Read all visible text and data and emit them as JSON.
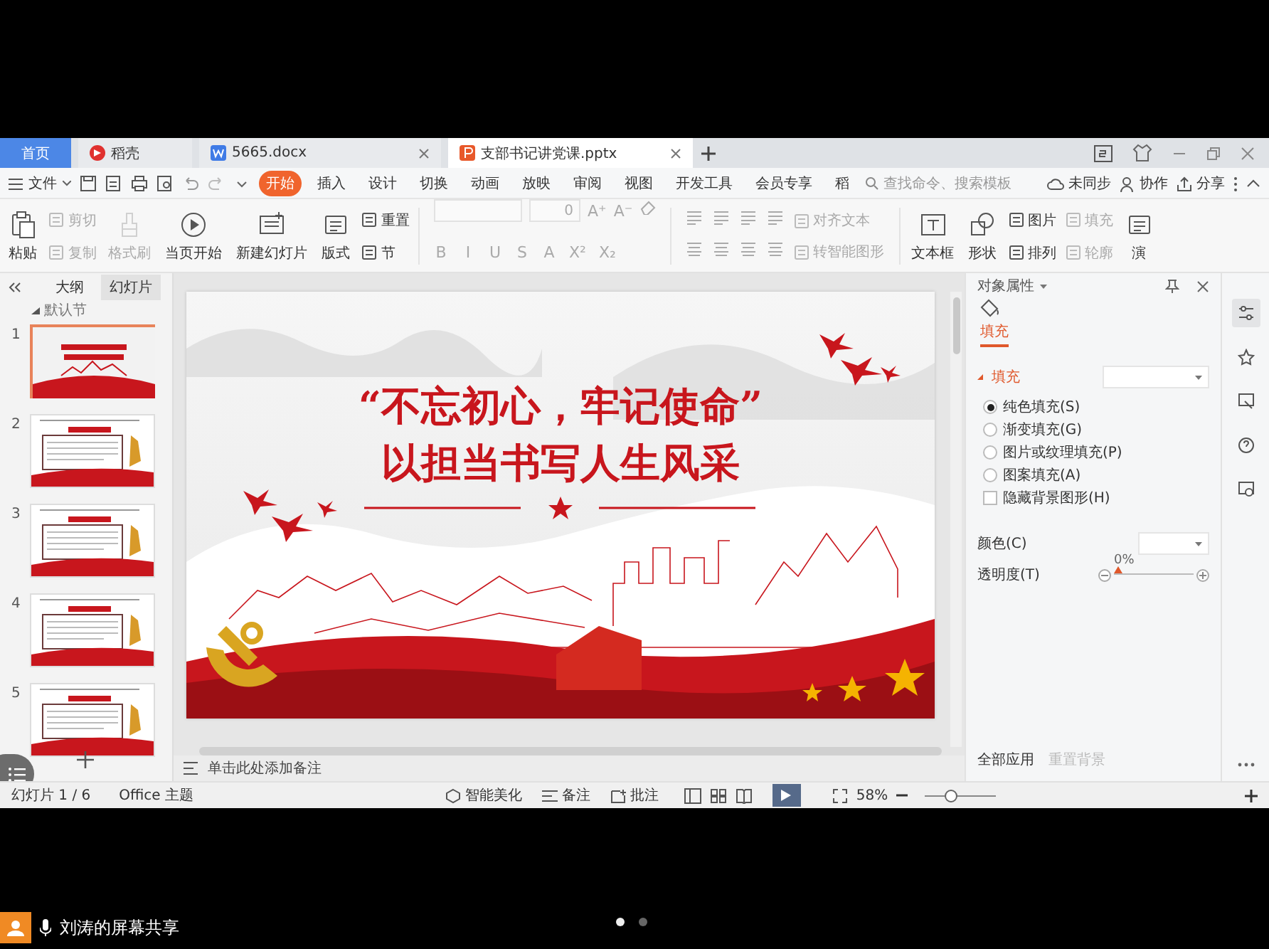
{
  "doc_tabs": [
    {
      "kind": "home",
      "label": "首页",
      "selected": false
    },
    {
      "kind": "store",
      "label": "稻壳",
      "selected": false
    },
    {
      "kind": "writer",
      "label": "5665.docx",
      "selected": false
    },
    {
      "kind": "presentation",
      "label": "支部书记讲党课.pptx",
      "selected": true
    }
  ],
  "menu": {
    "file": "文件",
    "tabs": [
      {
        "label": "开始",
        "selected": true
      },
      {
        "label": "插入",
        "selected": false
      },
      {
        "label": "设计",
        "selected": false
      },
      {
        "label": "切换",
        "selected": false
      },
      {
        "label": "动画",
        "selected": false
      },
      {
        "label": "放映",
        "selected": false
      },
      {
        "label": "审阅",
        "selected": false
      },
      {
        "label": "视图",
        "selected": false
      },
      {
        "label": "开发工具",
        "selected": false
      },
      {
        "label": "会员专享",
        "selected": false
      },
      {
        "label": "稻",
        "selected": false
      }
    ],
    "search": {
      "placeholder": "查找命令、搜索模板"
    },
    "actions": [
      {
        "kind": "cloud",
        "label": "未同步"
      },
      {
        "kind": "people",
        "label": "协作"
      },
      {
        "kind": "share",
        "label": "分享"
      }
    ]
  },
  "ribbon": [
    {
      "kind": "big",
      "label": "粘贴",
      "disabled": false
    },
    {
      "kind": "stack",
      "items": [
        {
          "label": "剪切",
          "disabled": true
        },
        {
          "label": "复制",
          "disabled": true
        }
      ]
    },
    {
      "kind": "big",
      "label": "格式刷",
      "disabled": true
    },
    {
      "kind": "big",
      "label": "当页开始",
      "disabled": false
    },
    {
      "kind": "big",
      "label": "新建幻灯片",
      "disabled": false
    },
    {
      "kind": "big",
      "label": "版式",
      "disabled": false
    },
    {
      "kind": "stack",
      "items": [
        {
          "label": "重置",
          "disabled": false
        },
        {
          "label": "节",
          "disabled": false
        }
      ]
    },
    {
      "kind": "font",
      "font_size": "0",
      "size_buttons": [
        "A⁺",
        "A⁻"
      ],
      "format_buttons": [
        "B",
        "I",
        "U",
        "S",
        "A",
        "X²",
        "X₂"
      ]
    },
    {
      "kind": "paragraph",
      "items": [
        {
          "label": "对齐文本",
          "disabled": true
        },
        {
          "label": "转智能图形",
          "disabled": true
        }
      ]
    },
    {
      "kind": "big",
      "label": "文本框",
      "disabled": false
    },
    {
      "kind": "big",
      "label": "形状",
      "disabled": false
    },
    {
      "kind": "stack",
      "items": [
        {
          "label": "图片",
          "disabled": false
        },
        {
          "label": "排列",
          "disabled": false
        }
      ]
    },
    {
      "kind": "stack",
      "items": [
        {
          "label": "填充",
          "disabled": true
        },
        {
          "label": "轮廓",
          "disabled": true
        }
      ]
    },
    {
      "kind": "big",
      "label": "演",
      "disabled": false
    }
  ],
  "slides_panel": {
    "tabs": [
      {
        "label": "大纲",
        "selected": false
      },
      {
        "label": "幻灯片",
        "selected": true
      }
    ],
    "section": "默认节",
    "slides": [
      {
        "number": "1",
        "selected": true
      },
      {
        "number": "2",
        "selected": false
      },
      {
        "number": "3",
        "selected": false
      },
      {
        "number": "4",
        "selected": false
      },
      {
        "number": "5",
        "selected": false
      }
    ]
  },
  "slide": {
    "title_lines": [
      "“不忘初心，牢记使命”",
      "以担当书写人生风采"
    ]
  },
  "notes_placeholder": "单击此处添加备注",
  "properties": {
    "title": "对象属性",
    "tabs": [
      {
        "label": "填充",
        "selected": true
      }
    ],
    "section": "填充",
    "fill_options": [
      {
        "label": "纯色填充(S)",
        "selected": true
      },
      {
        "label": "渐变填充(G)",
        "selected": false
      },
      {
        "label": "图片或纹理填充(P)",
        "selected": false
      },
      {
        "label": "图案填充(A)",
        "selected": false
      }
    ],
    "hide_background": {
      "label": "隐藏背景图形(H)",
      "checked": false
    },
    "color_label": "颜色(C)",
    "transparency": {
      "label": "透明度(T)",
      "reading": "0%",
      "level": 0
    },
    "footer": [
      {
        "label": "全部应用",
        "disabled": false
      },
      {
        "label": "重置背景",
        "disabled": true
      }
    ]
  },
  "status_bar": {
    "slide_counter": "幻灯片 1 / 6",
    "theme": "Office 主题",
    "tools": [
      {
        "kind": "beautify",
        "label": "智能美化"
      },
      {
        "kind": "notes",
        "label": "备注"
      },
      {
        "kind": "comments",
        "label": "批注"
      }
    ],
    "zoom": {
      "reading": "58%",
      "level": 0.35
    }
  },
  "share": {
    "label": "刘涛的屏幕共享",
    "pages": [
      {
        "selected": true
      },
      {
        "selected": false
      }
    ]
  }
}
